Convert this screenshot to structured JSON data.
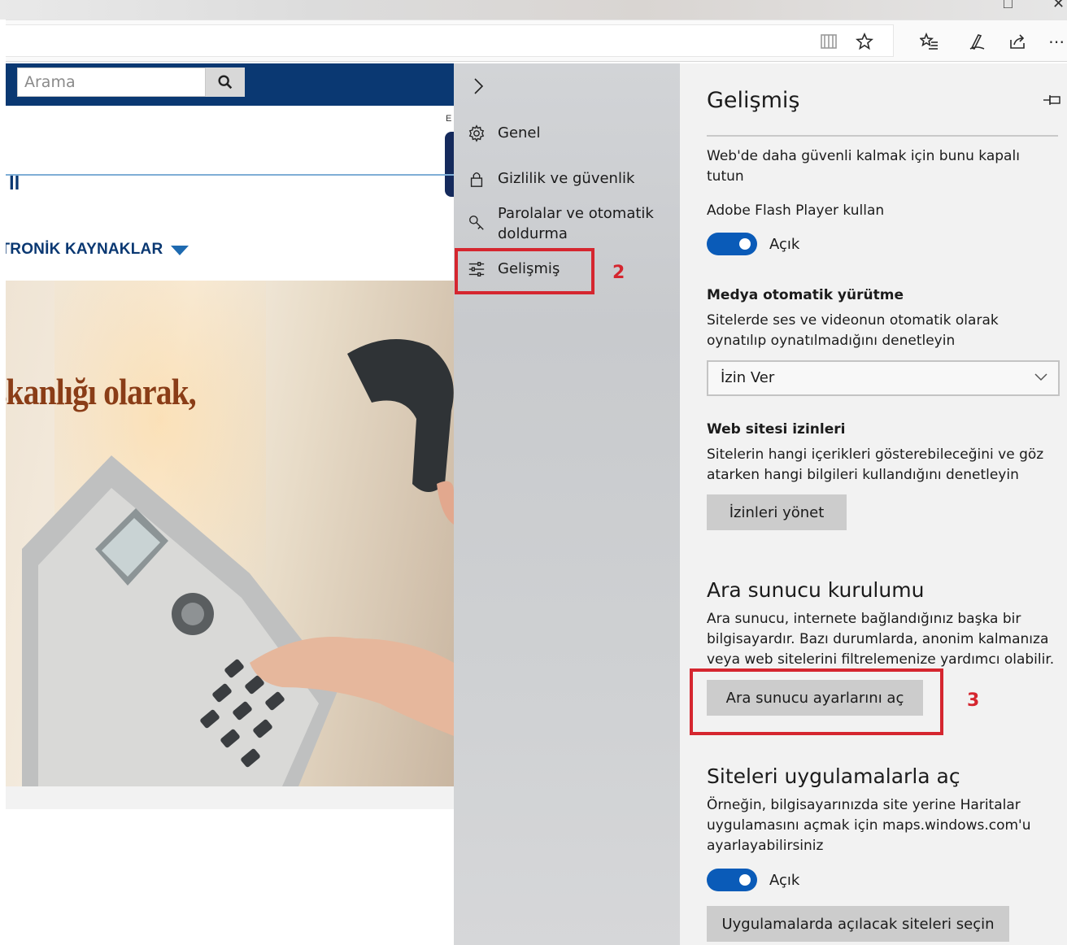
{
  "browser": {
    "toolbar_icons": [
      "reading-view-icon",
      "favorite-star-icon",
      "favorites-hub-icon",
      "web-note-icon",
      "share-icon",
      "more-icon"
    ]
  },
  "webpage": {
    "search_placeholder": "Arama",
    "nav_text": "İTRONİK KAYNAKLAR",
    "logo_letter": "E",
    "hero_title": "şkanlığı olarak,",
    "brand_colors": {
      "header": "#0a3872",
      "hero_title": "#8a3d17"
    }
  },
  "settings_nav": {
    "items": [
      {
        "label": "Genel",
        "icon": "gear-icon"
      },
      {
        "label": "Gizlilik ve güvenlik",
        "icon": "lock-icon"
      },
      {
        "label": "Parolalar ve otomatik doldurma",
        "icon": "key-icon"
      },
      {
        "label": "Gelişmiş",
        "icon": "sliders-icon"
      }
    ],
    "annotation_2": "2"
  },
  "settings": {
    "title": "Gelişmiş",
    "flash_note": "Web'de daha güvenli kalmak için bunu kapalı tutun",
    "flash_label": "Adobe Flash Player kullan",
    "flash_toggle_state": "Açık",
    "media_heading": "Medya otomatik yürütme",
    "media_desc": "Sitelerde ses ve videonun otomatik olarak oynatılıp oynatılmadığını denetleyin",
    "media_select_value": "İzin Ver",
    "permissions_heading": "Web sitesi izinleri",
    "permissions_desc": "Sitelerin hangi içerikleri gösterebileceğini ve göz atarken hangi bilgileri kullandığını denetleyin",
    "permissions_button": "İzinleri yönet",
    "proxy_heading": "Ara sunucu kurulumu",
    "proxy_desc": "Ara sunucu, internete bağlandığınız başka bir bilgisayardır. Bazı durumlarda, anonim kalmanıza veya web sitelerini filtrelemenize yardımcı olabilir.",
    "proxy_button": "Ara sunucu ayarlarını aç",
    "annotation_3": "3",
    "apps_heading": "Siteleri uygulamalarla aç",
    "apps_desc": "Örneğin, bilgisayarınızda site yerine Haritalar uygulamasını açmak için maps.windows.com'u ayarlayabilirsiniz",
    "apps_toggle_state": "Açık",
    "apps_button": "Uygulamalarda açılacak siteleri seçin",
    "colors": {
      "toggle_on": "#0a5bb8",
      "annotation": "#d5262f"
    }
  }
}
